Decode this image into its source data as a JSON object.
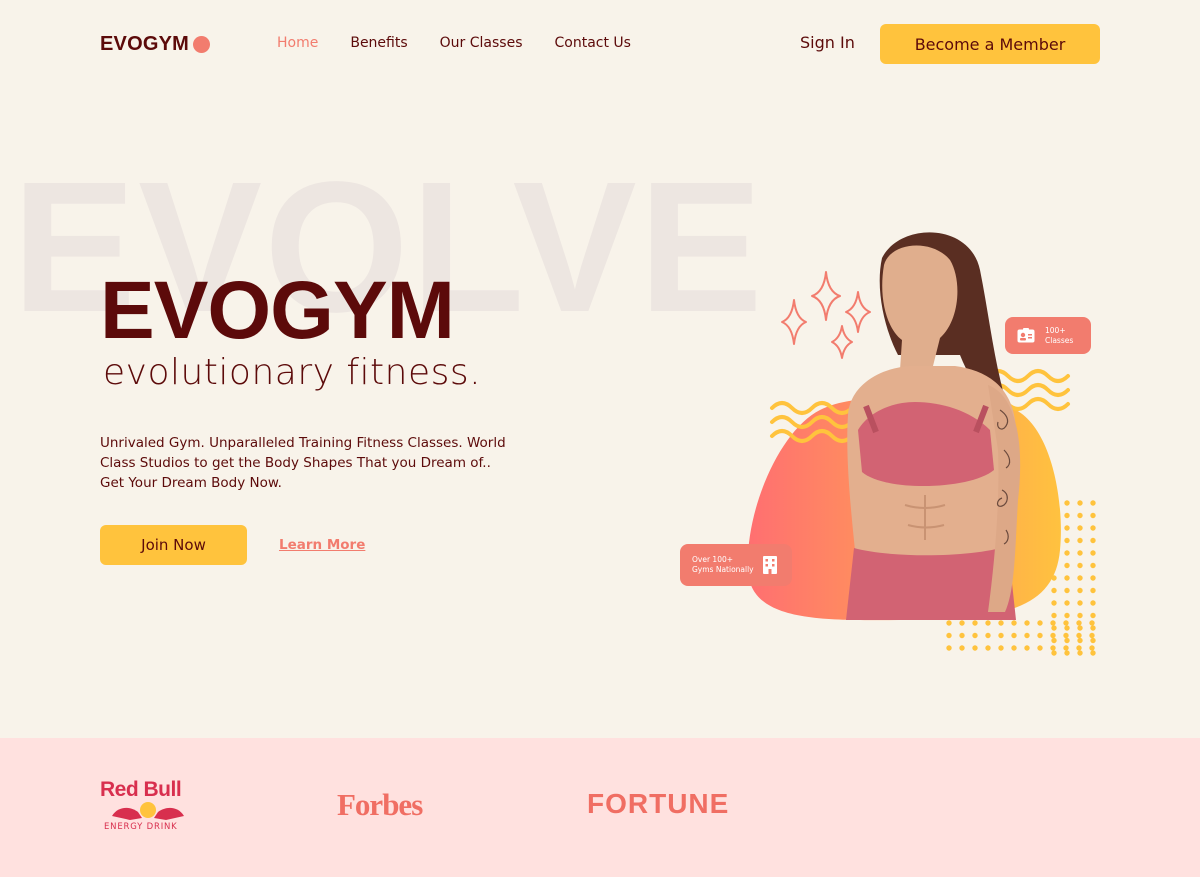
{
  "nav": {
    "logo": "EVOGYM",
    "links": [
      {
        "label": "Home",
        "active": true
      },
      {
        "label": "Benefits",
        "active": false
      },
      {
        "label": "Our Classes",
        "active": false
      },
      {
        "label": "Contact Us",
        "active": false
      }
    ],
    "sign_in": "Sign In",
    "cta": "Become a Member"
  },
  "hero": {
    "background_word": "EVOLVE",
    "title": "EVOGYM",
    "subtitle": "evolutionary fitness.",
    "description": "Unrivaled Gym. Unparalleled Training Fitness Classes. World Class Studios to get the Body Shapes That you Dream of.. Get Your Dream Body Now.",
    "join_button": "Join Now",
    "learn_more": "Learn More"
  },
  "graphic": {
    "badge_classes": {
      "line1": "100+",
      "line2": "Classes",
      "icon": "id-card-icon"
    },
    "badge_gyms": {
      "line1": "Over 100+",
      "line2": "Gyms Nationally",
      "icon": "building-icon"
    }
  },
  "sponsors": {
    "redbull": "Red Bull",
    "redbull_sub": "ENERGY DRINK",
    "forbes": "Forbes",
    "fortune": "FORTUNE"
  },
  "colors": {
    "background": "#F8F3EA",
    "primary_dark": "#5C0A0A",
    "accent_coral": "#F27C6E",
    "accent_yellow": "#FFC33D",
    "sponsor_band": "#FFE1DF"
  }
}
